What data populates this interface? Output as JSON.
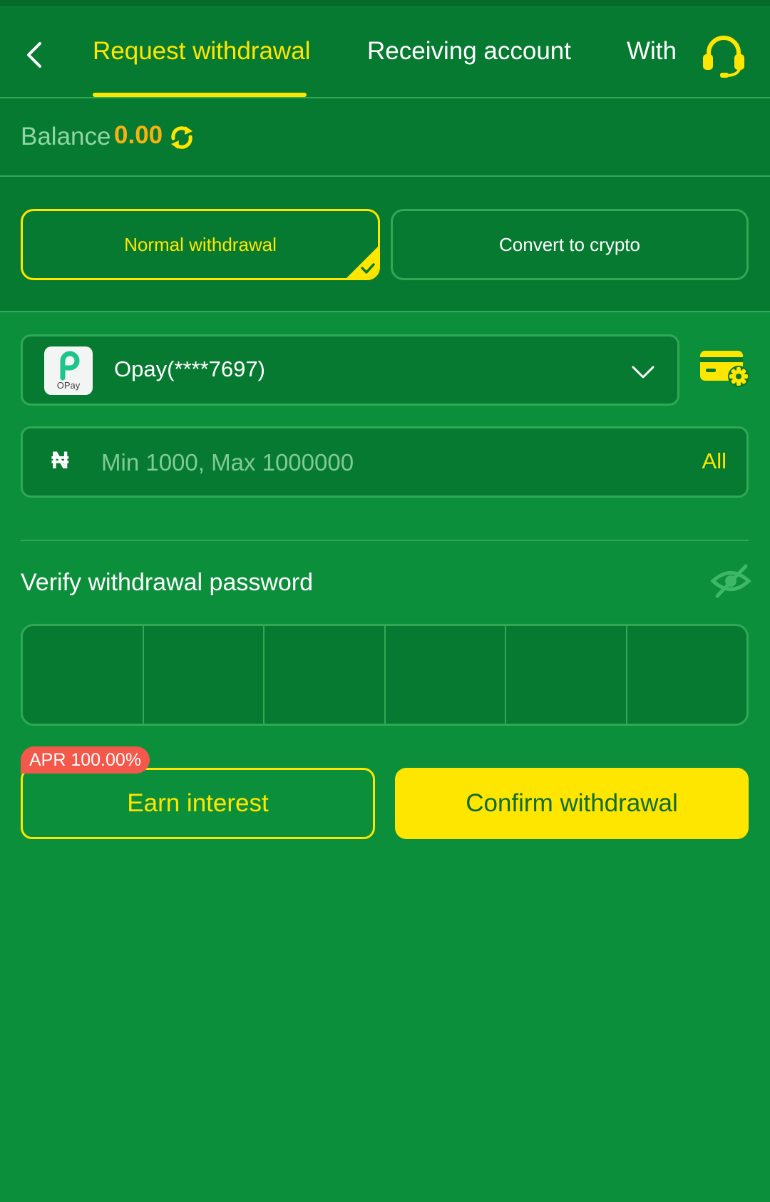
{
  "header": {
    "tabs": [
      {
        "label": "Request withdrawal",
        "active": true
      },
      {
        "label": "Receiving account",
        "active": false
      },
      {
        "label": "With",
        "active": false
      }
    ]
  },
  "balance": {
    "label": "Balance",
    "value": "0.00"
  },
  "withdraw_modes": {
    "normal": "Normal withdrawal",
    "crypto": "Convert to crypto",
    "selected": "normal"
  },
  "account": {
    "provider_logo_text": "OPay",
    "display": "Opay(****7697)"
  },
  "amount": {
    "currency_symbol": "₦",
    "placeholder": "Min 1000, Max 1000000",
    "all_label": "All"
  },
  "password": {
    "label": "Verify withdrawal password",
    "digits": 6
  },
  "actions": {
    "apr_badge": "APR 100.00%",
    "earn_label": "Earn interest",
    "confirm_label": "Confirm withdrawal"
  },
  "colors": {
    "background": "#0b8f3a",
    "panel": "#077a31",
    "accent": "#ffe600",
    "balance": "#f7b20f",
    "badge": "#f4584a"
  }
}
